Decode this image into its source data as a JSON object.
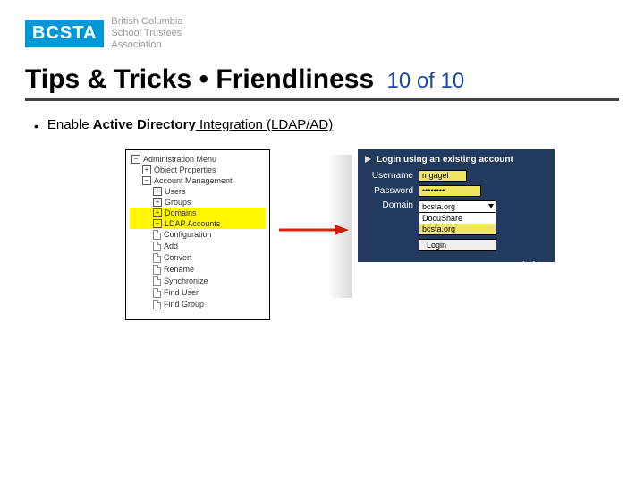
{
  "logo": {
    "mark": "BCSTA",
    "line1": "British Columbia",
    "line2": "School Trustees",
    "line3": "Association"
  },
  "title": {
    "main": "Tips & Tricks",
    "sep": "•",
    "topic": "Friendliness",
    "count": "10 of 10"
  },
  "bullet": {
    "pre": "Enable ",
    "bold": "Active Directory",
    "post": " Integration (LDAP/AD)"
  },
  "tree": {
    "items": [
      {
        "lvl": 1,
        "icon": "minus",
        "label": "Administration Menu"
      },
      {
        "lvl": 2,
        "icon": "plus",
        "label": "Object Properties"
      },
      {
        "lvl": 2,
        "icon": "minus",
        "label": "Account Management"
      },
      {
        "lvl": 3,
        "icon": "plus",
        "label": "Users"
      },
      {
        "lvl": 3,
        "icon": "plus",
        "label": "Groups"
      },
      {
        "lvl": 3,
        "icon": "plus",
        "label": "Domains",
        "hl": true
      },
      {
        "lvl": 3,
        "icon": "minus",
        "label": "LDAP Accounts",
        "hl": true
      },
      {
        "lvl": 3,
        "icon": "page",
        "label": "Configuration"
      },
      {
        "lvl": 3,
        "icon": "page",
        "label": "Add"
      },
      {
        "lvl": 3,
        "icon": "page",
        "label": "Convert"
      },
      {
        "lvl": 3,
        "icon": "page",
        "label": "Rename"
      },
      {
        "lvl": 3,
        "icon": "page",
        "label": "Synchronize"
      },
      {
        "lvl": 3,
        "icon": "page",
        "label": "Find User"
      },
      {
        "lvl": 3,
        "icon": "page",
        "label": "Find Group"
      }
    ]
  },
  "login": {
    "header": "Login using an existing account",
    "user_label": "Username",
    "user_value": "mgagel",
    "pass_label": "Password",
    "pass_value": "••••••••",
    "domain_label": "Domain",
    "domain_selected": "bcsta.org",
    "domain_options": [
      "DocuShare",
      "bcsta.org"
    ],
    "button": "Login",
    "footer": "for future"
  }
}
